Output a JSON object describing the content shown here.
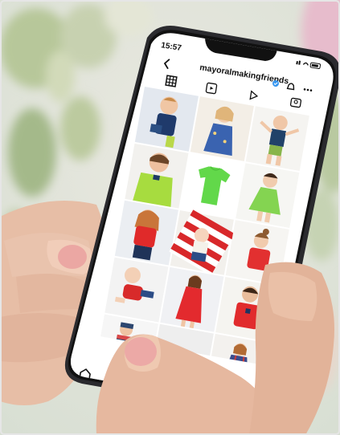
{
  "status_bar": {
    "time": "15:57"
  },
  "profile": {
    "username": "mayoralmakingfriends",
    "verified": true
  },
  "icons": {
    "back": "chevron-left-icon",
    "threads": "threads-icon",
    "notifications": "bell-icon",
    "more": "more-dots-icon",
    "grid_tab": "grid-icon",
    "reels_tab": "reels-icon",
    "video_tab": "play-icon",
    "tagged_tab": "tagged-icon",
    "home": "home-icon",
    "search": "search-icon"
  },
  "grid_posts": [
    {
      "id": "p1",
      "desc": "boy-navy-polo"
    },
    {
      "id": "p2",
      "desc": "girl-blue-dress"
    },
    {
      "id": "p3",
      "desc": "boy-jumping"
    },
    {
      "id": "p4",
      "desc": "boy-green-polo"
    },
    {
      "id": "p5",
      "desc": "green-shirt"
    },
    {
      "id": "p6",
      "desc": "girl-green-dress"
    },
    {
      "id": "p7",
      "desc": "girl-red-top"
    },
    {
      "id": "p8",
      "desc": "baby-on-blanket"
    },
    {
      "id": "p9",
      "desc": "girl-red-shirt"
    },
    {
      "id": "p10",
      "desc": "baby-red-outfit"
    },
    {
      "id": "p11",
      "desc": "girl-red-dress"
    },
    {
      "id": "p12",
      "desc": "boy-red-polo"
    },
    {
      "id": "p13",
      "desc": "boy-plaid-shirt"
    },
    {
      "id": "p14",
      "desc": "hidden-by-finger"
    },
    {
      "id": "p15",
      "desc": "girl-plaid-dress"
    }
  ],
  "colors": {
    "phone_frame": "#2a2a2e",
    "screen_bg": "#ffffff",
    "accent_blue": "#3897f0"
  }
}
